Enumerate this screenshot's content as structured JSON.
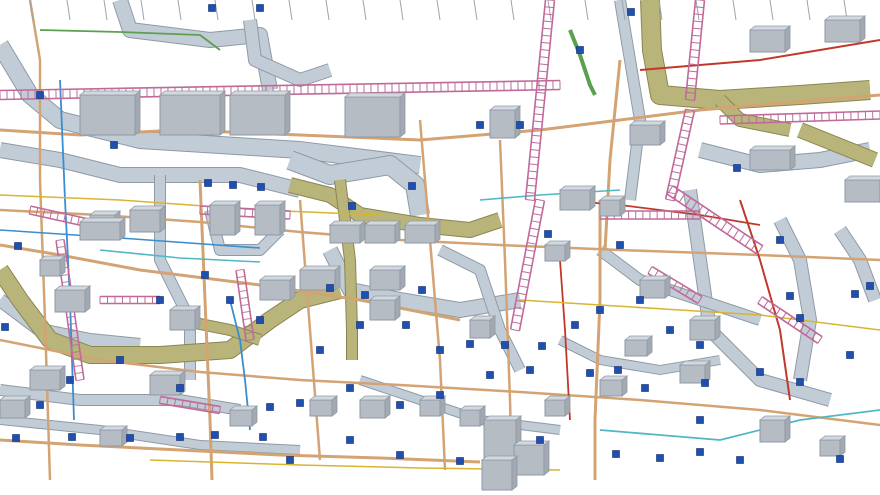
{
  "scene": {
    "subject": "mep-ceiling-services-3d-model",
    "colors": {
      "background": "#ffffff",
      "air_duct": "#c2ccd6",
      "air_duct_edge": "#8e9aa6",
      "olive_duct": "#b8b47a",
      "olive_duct_edge": "#8a8650",
      "pipe_tan": "#d4a373",
      "cable_tray": "#c06a9a",
      "pipe_red": "#c0392b",
      "pipe_blue": "#3a8ed0",
      "pipe_cyan": "#4fb8c4",
      "pipe_yellow": "#d8b430",
      "pipe_green": "#5aa050",
      "equipment_box": "#b5bcc4",
      "valve": "#1f4fb0"
    }
  }
}
